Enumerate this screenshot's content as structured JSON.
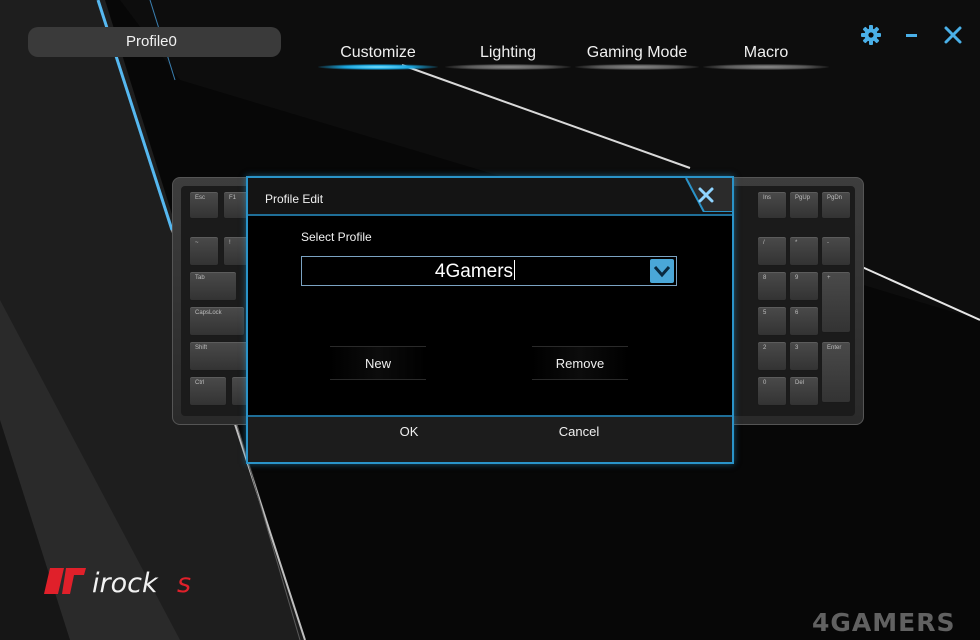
{
  "profile": {
    "current": "Profile0"
  },
  "nav": {
    "tabs": [
      {
        "label": "Customize",
        "active": true
      },
      {
        "label": "Lighting",
        "active": false
      },
      {
        "label": "Gaming Mode",
        "active": false
      },
      {
        "label": "Macro",
        "active": false
      }
    ]
  },
  "window_controls": {
    "settings_icon": "gear-icon",
    "minimize_icon": "minimize-icon",
    "close_icon": "close-icon"
  },
  "keyboard": {
    "keys": [
      "Esc",
      "F1",
      "Ins",
      "PgUp",
      "PgDn",
      "~",
      "!",
      "/",
      "*",
      "-",
      "Tab",
      "8",
      "9",
      "+",
      "CapsLock",
      "5",
      "6",
      "Shift",
      "2",
      "3",
      "Enter",
      "Ctrl",
      "0",
      "Del"
    ]
  },
  "dialog": {
    "title": "Profile Edit",
    "select_label": "Select Profile",
    "selected_profile": "4Gamers",
    "new_label": "New",
    "remove_label": "Remove",
    "ok_label": "OK",
    "cancel_label": "Cancel"
  },
  "brand": {
    "logo_text": "irocks",
    "accent": "#e0202a"
  },
  "watermark": "4GAMERS",
  "colors": {
    "accent_blue": "#2a93c8",
    "background": "#070707"
  }
}
